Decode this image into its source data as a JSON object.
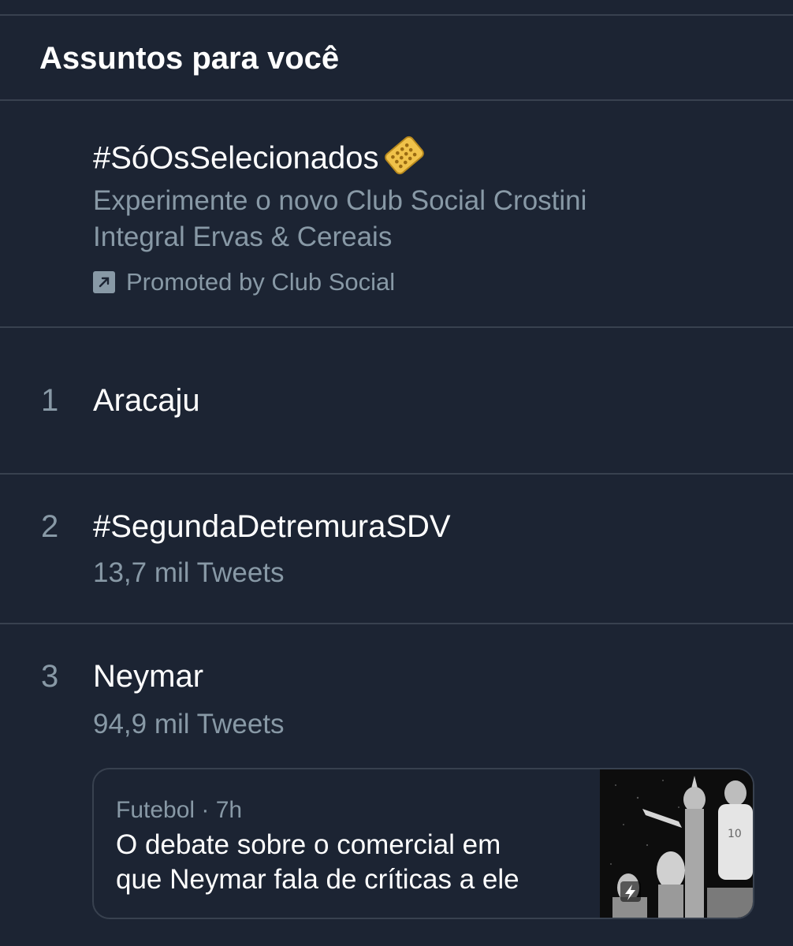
{
  "section": {
    "title": "Assuntos para você"
  },
  "promoted": {
    "hashtag": "#SóOsSelecionados",
    "emoji_icon": "cracker-emoji",
    "description_line1": "Experimente o novo Club Social Crostini",
    "description_line2": "Integral Ervas & Cereais",
    "promoted_by": "Promoted by Club Social"
  },
  "trends": [
    {
      "rank": "1",
      "name": "Aracaju"
    },
    {
      "rank": "2",
      "name": "#SegundaDetremuraSDV",
      "count": "13,7 mil Tweets"
    },
    {
      "rank": "3",
      "name": "Neymar",
      "count": "94,9 mil Tweets"
    }
  ],
  "news_card": {
    "meta": "Futebol · 7h",
    "headline_line1": "O debate sobre o comercial em",
    "headline_line2": "que Neymar fala de críticas a ele",
    "thumb_text": "10",
    "thumb_icon": "lightning-icon"
  },
  "colors": {
    "background": "#1c2433",
    "divider": "#38414f",
    "secondary_text": "#8899a6",
    "emoji": "#f0c24a"
  }
}
